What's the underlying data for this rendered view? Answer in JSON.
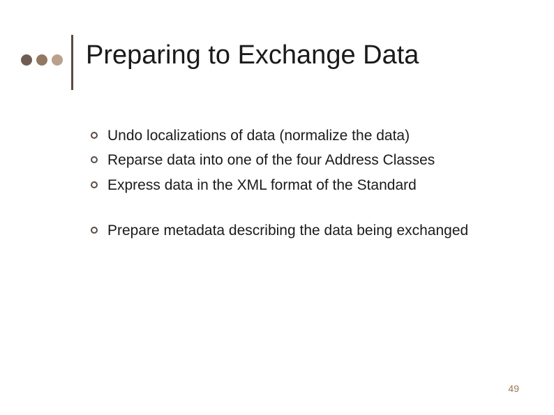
{
  "title": "Preparing to Exchange Data",
  "bullets_group1": [
    "Undo localizations of data (normalize the data)",
    "Reparse data into one of the four Address Classes",
    "Express data in the XML format of the Standard"
  ],
  "bullets_group2": [
    "Prepare metadata describing the data being exchanged"
  ],
  "page_number": "49"
}
